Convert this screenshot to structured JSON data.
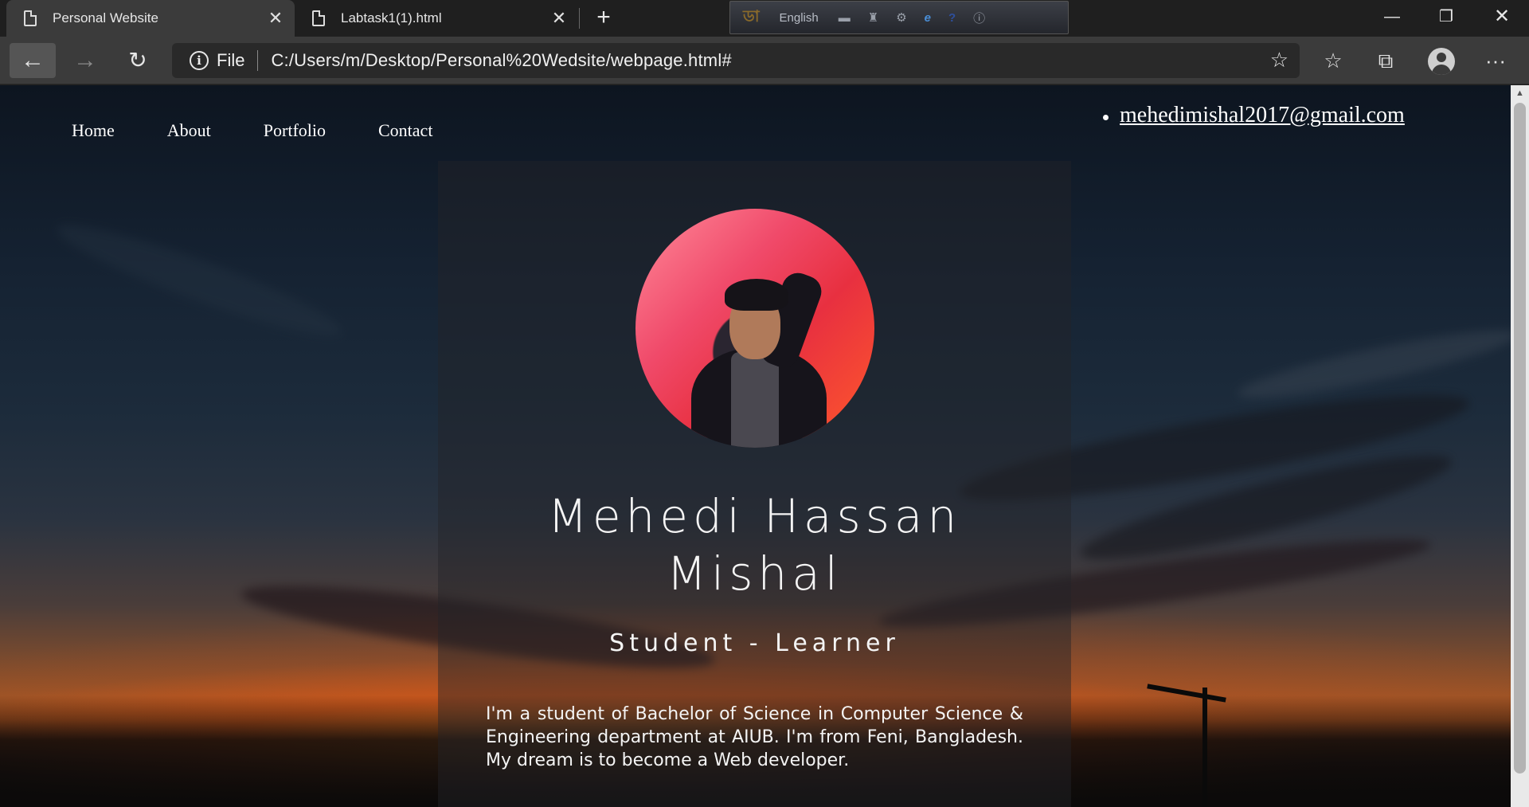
{
  "browser": {
    "tabs": [
      {
        "title": "Personal Website",
        "active": true
      },
      {
        "title": "Labtask1(1).html",
        "active": false
      }
    ],
    "close_glyph": "✕",
    "new_tab_glyph": "+",
    "ime": {
      "language": "English"
    },
    "window_controls": {
      "minimize": "—",
      "maximize": "❐",
      "close": "✕"
    },
    "nav": {
      "back": "←",
      "forward": "→",
      "reload": "↻"
    },
    "address": {
      "info_glyph": "i",
      "scheme_label": "File",
      "url": "C:/Users/m/Desktop/Personal%20Wedsite/webpage.html#"
    },
    "toolbar_icons": {
      "add_favorite": "☆",
      "favorites": "☆",
      "collections": "⧉",
      "more": "···"
    }
  },
  "page": {
    "nav": [
      {
        "label": "Home"
      },
      {
        "label": "About"
      },
      {
        "label": "Portfolio"
      },
      {
        "label": "Contact"
      }
    ],
    "email": "mehedimishal2017@gmail.com",
    "profile": {
      "name_line1": "Mehedi Hassan",
      "name_line2": "Mishal",
      "role": "Student - Learner",
      "bio": "I'm a student of Bachelor of Science in Computer Science & Engineering department at AIUB. I'm from Feni, Bangladesh. My dream is to become a Web developer."
    }
  },
  "scrollbar": {
    "up_glyph": "▲"
  }
}
